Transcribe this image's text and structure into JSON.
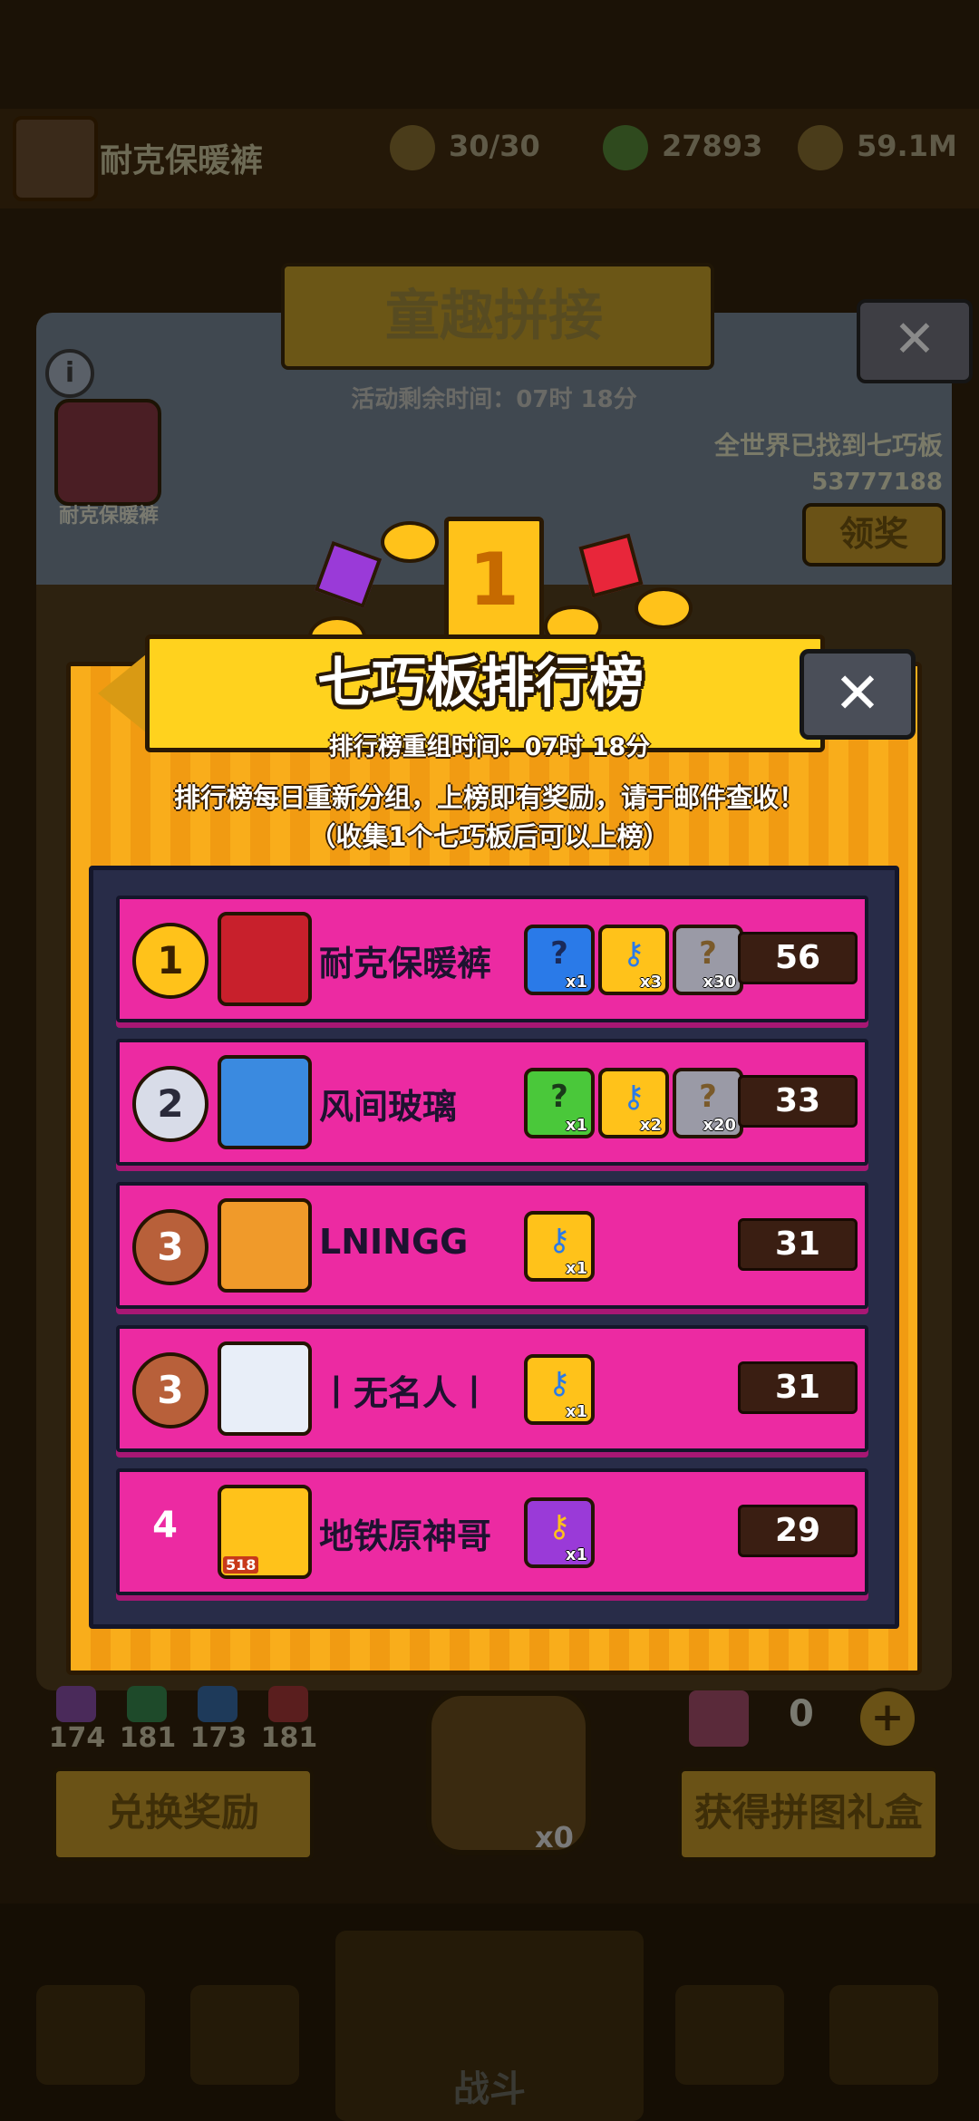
{
  "background": {
    "player_name": "耐克保暖裤",
    "resources": [
      {
        "icon": "energy-icon",
        "value": "30/30"
      },
      {
        "icon": "gem-icon",
        "value": "27893"
      },
      {
        "icon": "coin-icon",
        "value": "59.1M"
      }
    ],
    "event_title": "童趣拼接",
    "event_timer": "活动剩余时间：07时 18分",
    "found_label": "全世界已找到七巧板",
    "found_count": "53777188",
    "claim_label": "领奖",
    "mini_avatar_name": "耐克保暖裤",
    "piece_counts": [
      "174",
      "181",
      "173",
      "181"
    ],
    "exchange_label": "兑换奖励",
    "gift_label": "获得拼图礼盒",
    "gift_count": "0",
    "lock_count": "x0",
    "nav_center_label": "战斗",
    "colors": {
      "dim_bg": "#1b1206",
      "popup": "#f6a315",
      "row": "#ec2aa2",
      "panel": "#282c48"
    }
  },
  "popup": {
    "title": "七巧板排行榜",
    "close_label": "✕",
    "regroup_time": "排行榜重组时间：07时 18分",
    "notice_line1": "排行榜每日重新分组，上榜即有奖励，请于邮件查收！",
    "notice_line2": "（收集1个七巧板后可以上榜）"
  },
  "rows": [
    {
      "rank": "1",
      "medal": "gold",
      "name": "耐克保暖裤",
      "score": "56",
      "rewards": [
        {
          "icon": "mystery-box-blue-icon",
          "qty": "x1"
        },
        {
          "icon": "key-gold-icon",
          "qty": "x3"
        },
        {
          "icon": "mystery-card-gray-icon",
          "qty": "x30"
        }
      ]
    },
    {
      "rank": "2",
      "medal": "silver",
      "name": "风间玻璃",
      "score": "33",
      "rewards": [
        {
          "icon": "mystery-box-green-icon",
          "qty": "x1"
        },
        {
          "icon": "key-gold-icon",
          "qty": "x2"
        },
        {
          "icon": "mystery-card-gray-icon",
          "qty": "x20"
        }
      ]
    },
    {
      "rank": "3",
      "medal": "bronze",
      "name": "LNINGG",
      "score": "31",
      "rewards": [
        {
          "icon": "key-gold-icon",
          "qty": "x1"
        }
      ]
    },
    {
      "rank": "3",
      "medal": "bronze",
      "name": "丨无名人丨",
      "score": "31",
      "rewards": [
        {
          "icon": "key-gold-icon",
          "qty": "x1"
        }
      ]
    },
    {
      "rank": "4",
      "medal": "none",
      "name": "地铁原神哥",
      "score": "29",
      "avatar_badge": "518",
      "rewards": [
        {
          "icon": "key-purple-icon",
          "qty": "x1"
        }
      ]
    }
  ]
}
